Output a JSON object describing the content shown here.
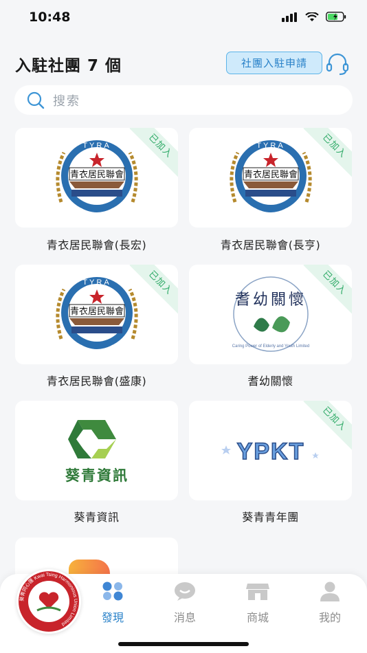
{
  "status": {
    "time": "10:48"
  },
  "header": {
    "title": "入駐社團 7 個",
    "join_label": "社團入駐申請"
  },
  "search": {
    "placeholder": "搜索"
  },
  "joined_badge": "已加入",
  "tyra_text": "TYRA",
  "tyra_name": "青衣居民聯會",
  "clubs": [
    {
      "name": "青衣居民聯會(長宏)",
      "joined": true
    },
    {
      "name": "青衣居民聯會(長亨)",
      "joined": true
    },
    {
      "name": "青衣居民聯會(盛康)",
      "joined": true
    },
    {
      "name": "耆幼關懷",
      "joined": true,
      "logo_title": "耆幼關懷",
      "logo_sub": "Caring Power of Elderly and Youth Limited"
    },
    {
      "name": "葵青資訊",
      "joined": false,
      "logo_text": "葵青資訊"
    },
    {
      "name": "葵青青年團",
      "joined": true,
      "logo_text": "YPKT"
    }
  ],
  "tabbar": {
    "promo_ring_text": "葵青同心匯 Kwai Tsing Harmonious Union Limited",
    "tabs": [
      {
        "label": "發現",
        "active": true
      },
      {
        "label": "消息",
        "active": false
      },
      {
        "label": "商城",
        "active": false
      },
      {
        "label": "我的",
        "active": false
      }
    ]
  },
  "colors": {
    "accent": "#2a82c9",
    "badge_green": "#2faa67",
    "ribbon_bg": "#e4f5ec"
  }
}
